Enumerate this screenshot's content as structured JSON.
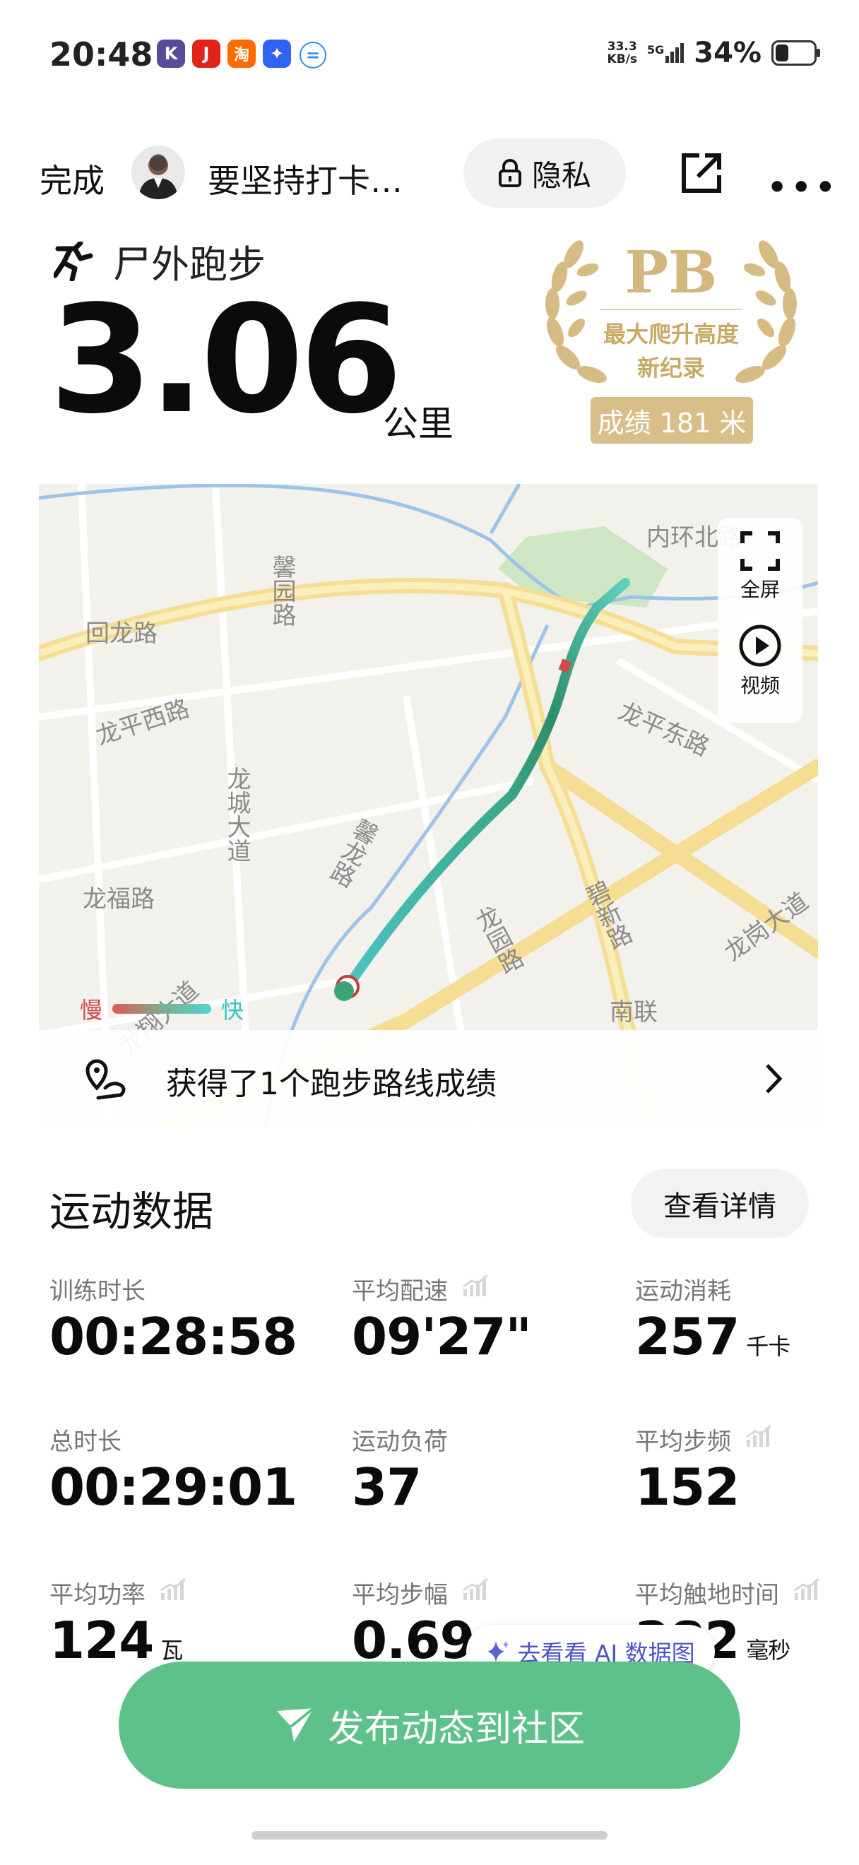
{
  "status_bar": {
    "time": "20:48",
    "apps": [
      {
        "name": "k-app-icon",
        "glyph": "K",
        "color": "#5a4a9a"
      },
      {
        "name": "jd-app-icon",
        "glyph": "J",
        "color": "#e2231a"
      },
      {
        "name": "taobao-app-icon",
        "glyph": "淘",
        "color": "#ff6a00"
      },
      {
        "name": "blue-app-icon",
        "glyph": "✦",
        "color": "#2f62f5"
      },
      {
        "name": "message-app-icon",
        "glyph": "=",
        "color": "#2f8ef5"
      }
    ],
    "net_speed_value": "33.3",
    "net_speed_unit": "KB/s",
    "network": "5G",
    "battery": "34%",
    "battery_level": 0.34
  },
  "header": {
    "done": "完成",
    "title": "要坚持打卡…",
    "privacy": "隐私"
  },
  "activity": {
    "type": "尸外跑步",
    "distance": "3.06",
    "distance_unit": "公里",
    "pb": {
      "label": "PB",
      "line1": "最大爬升高度",
      "line2": "新纪录",
      "badge": "成绩 181 米"
    }
  },
  "map": {
    "labels": {
      "neihuan": "内环北路",
      "xinyuan": "馨园路",
      "huilong": "回龙路",
      "longping_west": "龙平西路",
      "longping_east": "龙平东路",
      "longcheng": "龙城大道",
      "xinlong": "馨龙路",
      "longfu": "龙福路",
      "longyuan": "龙园路",
      "bixin": "碧新路",
      "longgang": "龙岗大道",
      "nanlian": "南联",
      "longxiang": "龙翔大道"
    },
    "fullscreen": "全屏",
    "video": "视频",
    "legend_slow": "慢",
    "legend_fast": "快",
    "route_achievement": "获得了1个跑步路线成绩"
  },
  "stats": {
    "title": "运动数据",
    "details_button": "查看详情",
    "items": [
      {
        "label": "训练时长",
        "value": "00:28:58",
        "unit": "",
        "chart": false
      },
      {
        "label": "平均配速",
        "value": "09'27\"",
        "unit": "",
        "chart": true
      },
      {
        "label": "运动消耗",
        "value": "257",
        "unit": "千卡",
        "chart": false
      },
      {
        "label": "总时长",
        "value": "00:29:01",
        "unit": "",
        "chart": false
      },
      {
        "label": "运动负荷",
        "value": "37",
        "unit": "",
        "chart": false
      },
      {
        "label": "平均步频",
        "value": "152",
        "unit": "",
        "chart": true
      },
      {
        "label": "平均功率",
        "value": "124",
        "unit": "瓦",
        "chart": true
      },
      {
        "label": "平均步幅",
        "value": "0.69",
        "unit": "",
        "chart": true
      },
      {
        "label": "平均触地时间",
        "value": "282",
        "unit": "毫秒",
        "chart": true
      }
    ]
  },
  "ai_button": "去看看 AI 数据图",
  "publish_button": "发布动态到社区",
  "colors": {
    "accent_green": "#5fc18a",
    "pb_gold": "#d4b77c",
    "ai_purple": "#4f53c9"
  }
}
